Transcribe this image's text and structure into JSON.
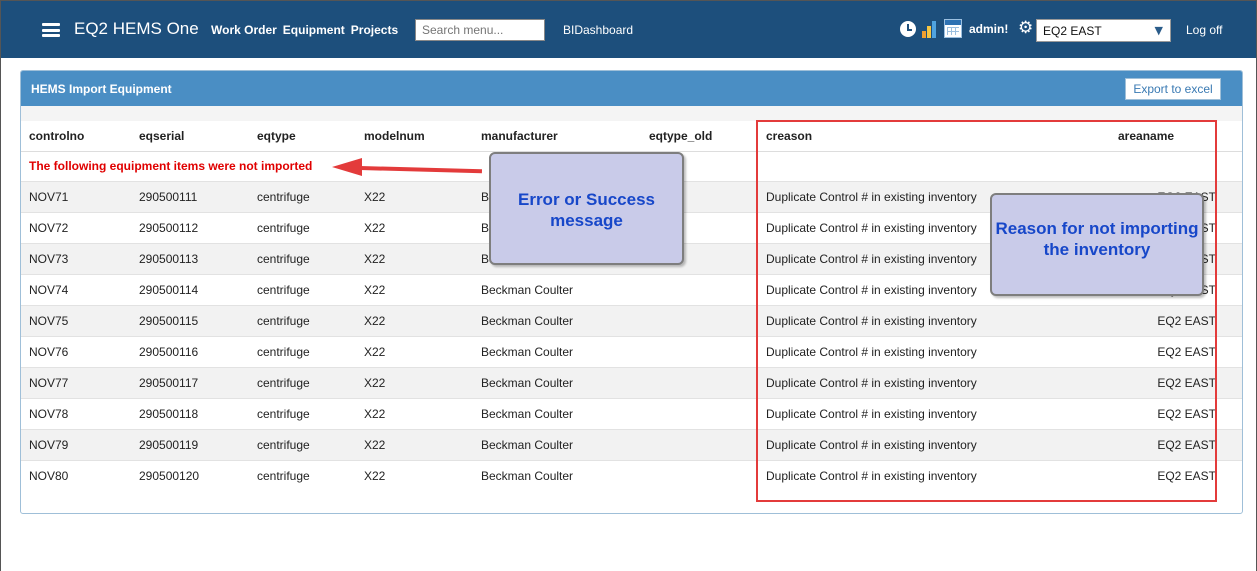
{
  "navbar": {
    "brand": "EQ2 HEMS One",
    "links": [
      "Work Order",
      "Equipment",
      "Projects"
    ],
    "search_placeholder": "Search menu...",
    "bidashboard": "BIDashboard",
    "user_label": "admin!",
    "area_selected": "EQ2 EAST",
    "logoff": "Log off",
    "icons": [
      "hamburger-icon",
      "clock-icon",
      "bar-chart-icon",
      "calendar-icon",
      "gear-icon",
      "chevron-down-icon"
    ]
  },
  "panel": {
    "title": "HEMS Import Equipment",
    "export_label": "Export to excel"
  },
  "table": {
    "headers": [
      "controlno",
      "eqserial",
      "eqtype",
      "modelnum",
      "manufacturer",
      "eqtype_old",
      "creason",
      "areaname"
    ],
    "message": "The following equipment items were not imported",
    "rows": [
      [
        "NOV71",
        "290500111",
        "centrifuge",
        "X22",
        "Beckman Coulter",
        "",
        "Duplicate Control # in existing inventory",
        "EQ2 EAST"
      ],
      [
        "NOV72",
        "290500112",
        "centrifuge",
        "X22",
        "Beckman Coulter",
        "",
        "Duplicate Control # in existing inventory",
        "EQ2 EAST"
      ],
      [
        "NOV73",
        "290500113",
        "centrifuge",
        "X22",
        "Beckman Coulter",
        "",
        "Duplicate Control # in existing inventory",
        "EQ2 EAST"
      ],
      [
        "NOV74",
        "290500114",
        "centrifuge",
        "X22",
        "Beckman Coulter",
        "",
        "Duplicate Control # in existing inventory",
        "EQ2 EAST"
      ],
      [
        "NOV75",
        "290500115",
        "centrifuge",
        "X22",
        "Beckman Coulter",
        "",
        "Duplicate Control # in existing inventory",
        "EQ2 EAST"
      ],
      [
        "NOV76",
        "290500116",
        "centrifuge",
        "X22",
        "Beckman Coulter",
        "",
        "Duplicate Control # in existing inventory",
        "EQ2 EAST"
      ],
      [
        "NOV77",
        "290500117",
        "centrifuge",
        "X22",
        "Beckman Coulter",
        "",
        "Duplicate Control # in existing inventory",
        "EQ2 EAST"
      ],
      [
        "NOV78",
        "290500118",
        "centrifuge",
        "X22",
        "Beckman Coulter",
        "",
        "Duplicate Control # in existing inventory",
        "EQ2 EAST"
      ],
      [
        "NOV79",
        "290500119",
        "centrifuge",
        "X22",
        "Beckman Coulter",
        "",
        "Duplicate Control # in existing inventory",
        "EQ2 EAST"
      ],
      [
        "NOV80",
        "290500120",
        "centrifuge",
        "X22",
        "Beckman Coulter",
        "",
        "Duplicate Control # in existing inventory",
        "EQ2 EAST"
      ]
    ]
  },
  "annotations": {
    "message_callout": "Error or Success message",
    "reason_callout": "Reason for not importing the inventory"
  },
  "colors": {
    "navbar": "#1d4f7c",
    "panel_header": "#4a8ec4",
    "error_text": "#e00000",
    "annotation_red": "#e33b3b",
    "callout_fill": "#c9cbe9",
    "callout_text": "#1747c9"
  }
}
